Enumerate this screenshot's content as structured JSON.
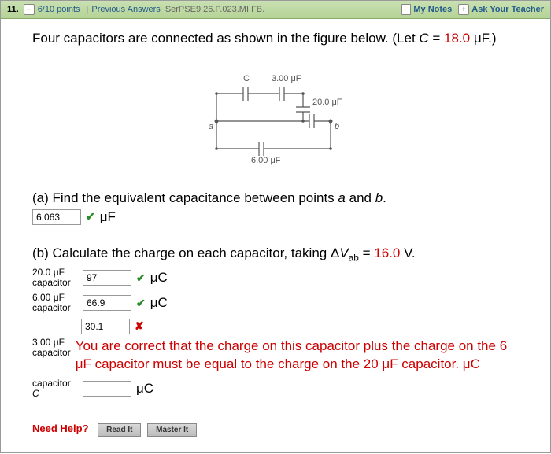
{
  "header": {
    "question_number": "11.",
    "points": "6/10 points",
    "prev_answers": "Previous Answers",
    "ser": "SerPSE9 26.P.023.MI.FB.",
    "my_notes": "My Notes",
    "ask": "Ask Your Teacher"
  },
  "question": {
    "text_before": "Four capacitors are connected as shown in the figure below. (Let ",
    "var": "C",
    "equals": " = ",
    "value": "18.0",
    "text_after": " μF.)"
  },
  "figure": {
    "c_label": "C",
    "top_right": "3.00 μF",
    "mid_right": "20.0 μF",
    "bottom": "6.00 μF",
    "a": "a",
    "b": "b"
  },
  "part_a": {
    "prompt": "(a) Find the equivalent capacitance between points ",
    "a": "a",
    "and": " and ",
    "b": "b",
    "dot": ".",
    "answer": "6.063",
    "unit": "μF"
  },
  "part_b": {
    "prompt_before": "(b) Calculate the charge on each capacitor, taking Δ",
    "var": "V",
    "sub": "ab",
    "equals": " = ",
    "value": "16.0",
    "after": " V.",
    "rows": [
      {
        "label1": "20.0 μF",
        "label2": "capacitor",
        "answer": "97",
        "mark": "check",
        "unit": "μC"
      },
      {
        "label1": "6.00 μF",
        "label2": "capacitor",
        "answer": "66.9",
        "mark": "check",
        "unit": "μC"
      }
    ],
    "wrong_answer": "30.1",
    "row3_label1": "3.00 μF",
    "row3_label2": "capacitor",
    "feedback": "You are correct that the charge on this capacitor plus the charge on the 6 μF capacitor must be equal to the charge on the 20 μF capacitor. μC",
    "row4_label1": "capacitor",
    "row4_label2": "C",
    "row4_answer": "",
    "row4_unit": "μC"
  },
  "help": {
    "label": "Need Help?",
    "read": "Read It",
    "master": "Master It"
  }
}
